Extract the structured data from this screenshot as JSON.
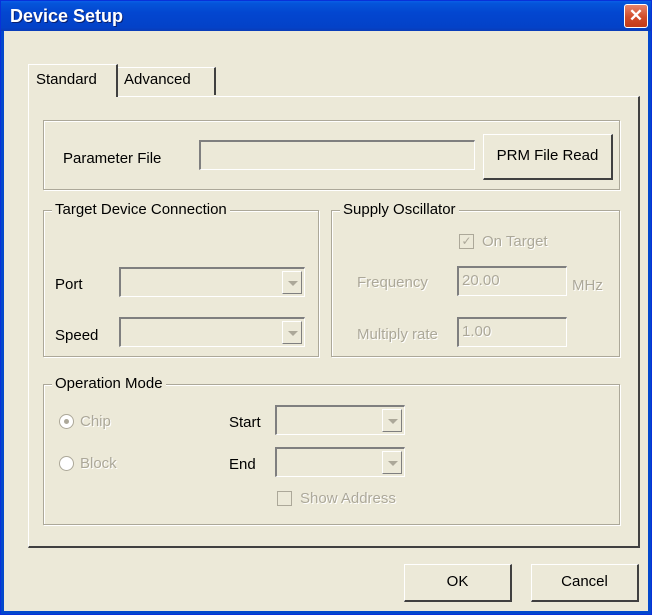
{
  "window": {
    "title": "Device Setup",
    "close_label": "✕"
  },
  "tabs": [
    {
      "label": "Standard",
      "active": true
    },
    {
      "label": "Advanced",
      "active": false
    }
  ],
  "parameter_file": {
    "label": "Parameter File",
    "value": "",
    "button_label": "PRM File Read"
  },
  "target_connection": {
    "title": "Target Device Connection",
    "port_label": "Port",
    "port_value": "",
    "speed_label": "Speed",
    "speed_value": ""
  },
  "supply_oscillator": {
    "title": "Supply Oscillator",
    "on_target_label": "On Target",
    "on_target_checked": true,
    "check_glyph": "✓",
    "frequency_label": "Frequency",
    "frequency_value": "20.00",
    "frequency_unit": "MHz",
    "multiply_label": "Multiply rate",
    "multiply_value": "1.00"
  },
  "operation_mode": {
    "title": "Operation Mode",
    "chip_label": "Chip",
    "chip_selected": true,
    "block_label": "Block",
    "start_label": "Start",
    "start_value": "",
    "end_label": "End",
    "end_value": "",
    "show_address_label": "Show Address",
    "show_address_checked": false
  },
  "footer": {
    "ok_label": "OK",
    "cancel_label": "Cancel"
  },
  "colors": {
    "titlebar": "#0454d9",
    "face": "#ece9d8",
    "disabled_text": "#aca899"
  }
}
